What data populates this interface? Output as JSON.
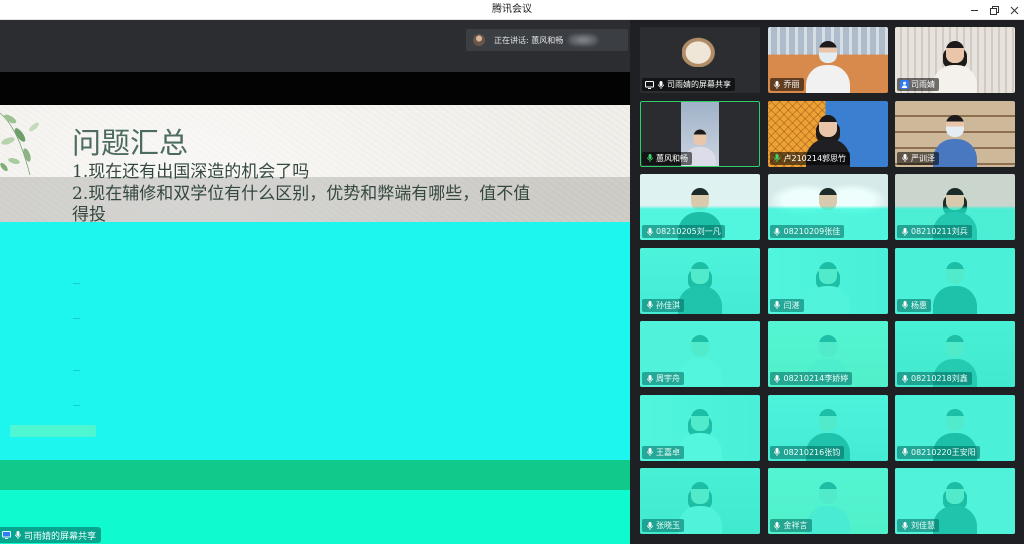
{
  "window": {
    "title": "腾讯会议",
    "icons": {
      "minimize": "minimize-icon",
      "restore": "restore-icon",
      "close": "close-icon"
    }
  },
  "stage": {
    "speaking_label": "正在讲话: 蕙风和畅",
    "slide": {
      "title": "问题汇总",
      "lines": [
        "1.现在还有出国深造的机会了吗",
        "2.现在辅修和双学位有什么区别，优势和弊端有哪些，值不值",
        "得投"
      ]
    },
    "share_label": "司雨婧的屏幕共享"
  },
  "participants": [
    {
      "name": "司雨婧的屏幕共享",
      "icon": "screen-share-icon"
    },
    {
      "name": "乔丽",
      "icon": "mic-icon"
    },
    {
      "name": "司雨婧",
      "icon": "host-icon"
    },
    {
      "name": "蕙风和畅",
      "icon": "mic-icon",
      "speaking": true
    },
    {
      "name": "卢210214郭思竹",
      "icon": "mic-icon"
    },
    {
      "name": "严训泽",
      "icon": "mic-icon"
    },
    {
      "name": "08210205刘一凡",
      "icon": "mic-icon"
    },
    {
      "name": "08210209张佳",
      "icon": "mic-icon"
    },
    {
      "name": "08210211刘兵",
      "icon": "mic-icon"
    },
    {
      "name": "孙佳淇",
      "icon": "mic-icon"
    },
    {
      "name": "闫湛",
      "icon": "mic-icon"
    },
    {
      "name": "杨惠",
      "icon": "mic-icon"
    },
    {
      "name": "周宇舟",
      "icon": "mic-icon"
    },
    {
      "name": "08210214李娇婷",
      "icon": "mic-icon"
    },
    {
      "name": "08210218刘鑫",
      "icon": "mic-icon"
    },
    {
      "name": "王嘉卓",
      "icon": "mic-icon"
    },
    {
      "name": "08210216张钧",
      "icon": "mic-icon"
    },
    {
      "name": "08210220王安阳",
      "icon": "mic-icon"
    },
    {
      "name": "张晓玉",
      "icon": "mic-icon"
    },
    {
      "name": "金祥言",
      "icon": "mic-icon"
    },
    {
      "name": "刘佳慧",
      "icon": "mic-icon"
    }
  ],
  "colors": {
    "active_speaker_border": "#2fcf6a",
    "host_badge": "#2f7cf6",
    "panel_background": "#1f2023",
    "slide_title": "#4d6c60"
  }
}
